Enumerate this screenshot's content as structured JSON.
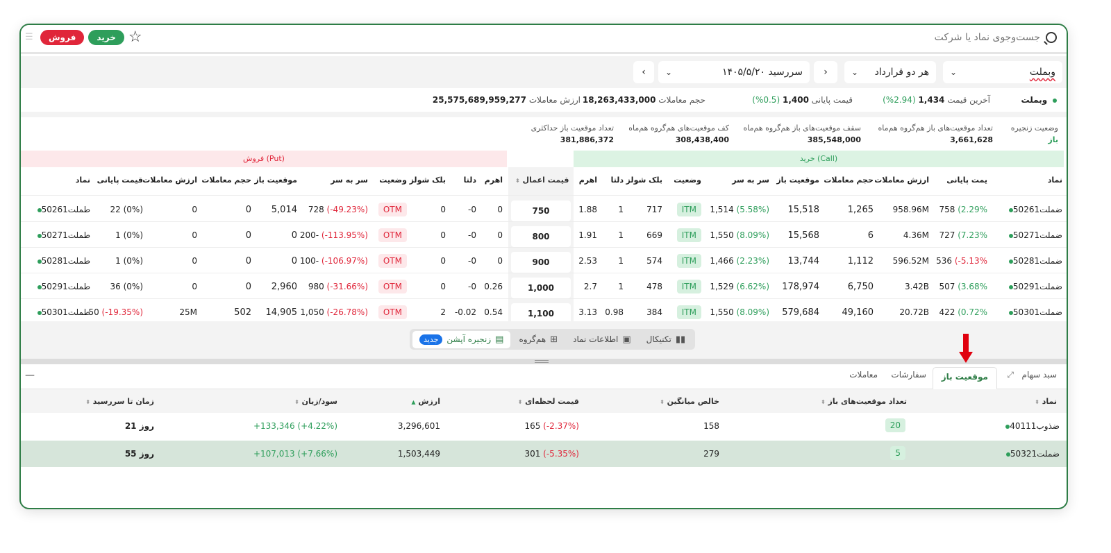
{
  "topbar": {
    "search_placeholder": "جست‌وجوی نماد یا شرکت",
    "buy_label": "خرید",
    "sell_label": "فروش"
  },
  "filters": {
    "symbol": "وبملت",
    "contract": "هر دو قرارداد",
    "expiry": "سررسید ۱۴۰۵/۵/۲۰"
  },
  "summary": {
    "symbol": "وبملت",
    "last_price_label": "آخرین قیمت",
    "last_price": "1,434",
    "last_change": "(2.94%)",
    "close_price_label": "قیمت پایانی",
    "close_price": "1,400",
    "close_change": "(0.5%)",
    "volume_label": "حجم معاملات",
    "volume": "18,263,433,000",
    "value_label": "ارزش معاملات",
    "value": "25,575,689,959,277"
  },
  "stats": {
    "chain_status_label": "وضعیت زنجیره",
    "chain_status": "باز",
    "open_count_label": "تعداد موقعیت‌های باز هم‌گروه هم‌ماه",
    "open_count": "3,661,628",
    "ceiling_label": "سقف موقعیت‌های باز هم‌گروه هم‌ماه",
    "ceiling": "385,548,000",
    "floor_label": "کف موقعیت‌های هم‌گروه هم‌ماه",
    "floor": "308,438,400",
    "max_label": "تعداد موقعیت باز حداکثری",
    "max": "381,886,372"
  },
  "chain": {
    "call_title": "خرید (Call)",
    "put_title": "فروش (Put)",
    "strike_header": "قیمت اعمال",
    "call_headers": [
      "نماد",
      "یمت پایانی",
      "ارزش معاملات",
      "حجم معاملات",
      "موقعیت باز",
      "سر به سر",
      "وضعیت",
      "بلک شولز",
      "دلتا",
      "اهرم"
    ],
    "put_headers": [
      "اهرم",
      "دلتا",
      "بلک شولز",
      "وضعیت",
      "سر به سر",
      "موقعیت باز",
      "حجم معاملات",
      "ارزش معاملات",
      "قیمت پایانی",
      "نماد"
    ],
    "rows": [
      {
        "strike": "750",
        "call": {
          "symbol": "ضملت50261",
          "close": "758",
          "close_pct": "(2.29%",
          "value": "958.96M",
          "volume": "1,265",
          "oi": "15,518",
          "be": "1,514",
          "be_pct": "(5.58%)",
          "status": "ITM",
          "bs": "717",
          "delta": "1",
          "lev": "1.88"
        },
        "put": {
          "lev": "0",
          "delta": "-0",
          "bs": "0",
          "status": "OTM",
          "be": "728",
          "be_pct": "(-49.23%)",
          "oi": "5,014",
          "volume": "0",
          "value": "0",
          "close": "22",
          "close_pct": "(0%)",
          "symbol": "طملت50261"
        }
      },
      {
        "strike": "800",
        "call": {
          "symbol": "ضملت50271",
          "close": "727",
          "close_pct": "(7.23%",
          "value": "4.36M",
          "volume": "6",
          "oi": "15,568",
          "be": "1,550",
          "be_pct": "(8.09%)",
          "status": "ITM",
          "bs": "669",
          "delta": "1",
          "lev": "1.91"
        },
        "put": {
          "lev": "0",
          "delta": "-0",
          "bs": "0",
          "status": "OTM",
          "be": "200-",
          "be_pct": "(-113.95%)",
          "oi": "0",
          "volume": "0",
          "value": "0",
          "close": "1",
          "close_pct": "(0%)",
          "symbol": "طملت50271"
        }
      },
      {
        "strike": "900",
        "call": {
          "symbol": "ضملت50281",
          "close": "536",
          "close_pct": "(-5.13%",
          "value": "596.52M",
          "volume": "1,112",
          "oi": "13,744",
          "be": "1,466",
          "be_pct": "(2.23%)",
          "status": "ITM",
          "bs": "574",
          "delta": "1",
          "lev": "2.53"
        },
        "put": {
          "lev": "0",
          "delta": "-0",
          "bs": "0",
          "status": "OTM",
          "be": "100-",
          "be_pct": "(-106.97%)",
          "oi": "0",
          "volume": "0",
          "value": "0",
          "close": "1",
          "close_pct": "(0%)",
          "symbol": "طملت50281"
        }
      },
      {
        "strike": "1,000",
        "call": {
          "symbol": "ضملت50291",
          "close": "507",
          "close_pct": "(3.68%",
          "value": "3.42B",
          "volume": "6,750",
          "oi": "178,974",
          "be": "1,529",
          "be_pct": "(6.62%)",
          "status": "ITM",
          "bs": "478",
          "delta": "1",
          "lev": "2.7"
        },
        "put": {
          "lev": "0.26",
          "delta": "-0",
          "bs": "0",
          "status": "OTM",
          "be": "980",
          "be_pct": "(-31.66%)",
          "oi": "2,960",
          "volume": "0",
          "value": "0",
          "close": "36",
          "close_pct": "(0%)",
          "symbol": "طملت50291"
        }
      },
      {
        "strike": "1,100",
        "call": {
          "symbol": "ضملت50301",
          "close": "422",
          "close_pct": "(0.72%",
          "value": "20.72B",
          "volume": "49,160",
          "oi": "579,684",
          "be": "1,550",
          "be_pct": "(8.09%)",
          "status": "ITM",
          "bs": "384",
          "delta": "0.98",
          "lev": "3.13"
        },
        "put": {
          "lev": "0.54",
          "delta": "-0.02",
          "bs": "2",
          "status": "OTM",
          "be": "1,050",
          "be_pct": "(-26.78%)",
          "oi": "14,905",
          "volume": "502",
          "value": "25M",
          "close": "50",
          "close_pct": "(-19.35%)",
          "symbol": "طملت50301"
        }
      }
    ]
  },
  "tabs": {
    "technical": "تکنیکال",
    "symbol_info": "اطلاعات نماد",
    "group": "هم‌گروه",
    "option_chain": "زنجیره آپشن",
    "new_badge": "جدید"
  },
  "panel_tabs": {
    "portfolio": "سبد سهام",
    "open_positions": "موقعیت باز",
    "orders": "سفارشات",
    "trades": "معاملات"
  },
  "positions": {
    "headers": {
      "symbol": "نماد",
      "open_count": "تعداد موقعیت‌های باز",
      "avg": "خالص میانگین",
      "price": "قیمت لحظه‌ای",
      "value": "ارزش",
      "pnl": "سود/زیان",
      "days": "زمان تا سررسید"
    },
    "rows": [
      {
        "symbol": "ضذوب40111",
        "open_count": "20",
        "avg": "158",
        "price": "165",
        "price_pct": "(-2.37%)",
        "value": "3,296,601",
        "pnl": "+133,346 (+4.22%)",
        "days": "21 روز"
      },
      {
        "symbol": "ضملت50321",
        "open_count": "5",
        "avg": "279",
        "price": "301",
        "price_pct": "(-5.35%)",
        "value": "1,503,449",
        "pnl": "+107,013 (+7.66%)",
        "days": "55 روز"
      }
    ]
  },
  "colors": {
    "brand_green": "#2e9e5b",
    "sell_red": "#e0263a",
    "frame": "#2e7d46"
  }
}
